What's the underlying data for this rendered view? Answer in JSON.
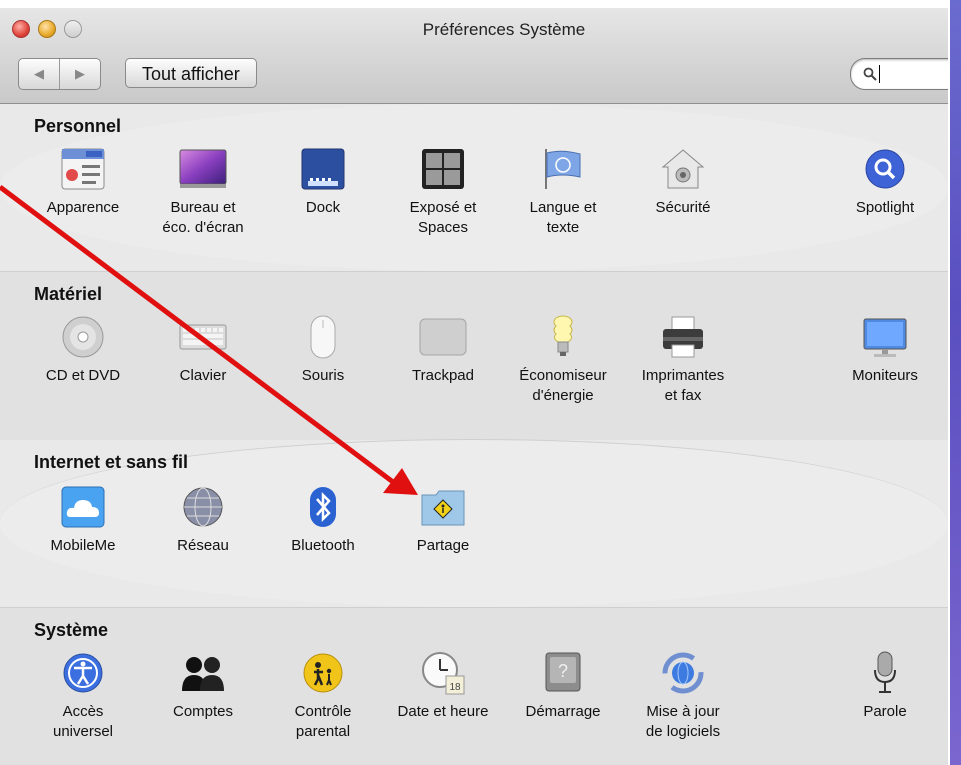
{
  "window": {
    "title": "Préférences Système"
  },
  "toolbar": {
    "back": "◀",
    "forward": "▶",
    "show_all": "Tout afficher"
  },
  "search": {
    "value": ""
  },
  "sections": [
    {
      "title": "Personnel",
      "items": [
        "Apparence",
        "Bureau et\néco. d'écran",
        "Dock",
        "Exposé et\nSpaces",
        "Langue et\ntexte",
        "Sécurité",
        "Spotlight"
      ]
    },
    {
      "title": "Matériel",
      "items": [
        "CD et DVD",
        "Clavier",
        "Souris",
        "Trackpad",
        "Économiseur\nd'énergie",
        "Imprimantes\net fax",
        "Moniteurs"
      ]
    },
    {
      "title": "Internet et sans fil",
      "items": [
        "MobileMe",
        "Réseau",
        "Bluetooth",
        "Partage"
      ]
    },
    {
      "title": "Système",
      "items": [
        "Accès\nuniversel",
        "Comptes",
        "Contrôle\nparental",
        "Date et heure",
        "Démarrage",
        "Mise à jour\nde logiciels",
        "Parole"
      ]
    }
  ],
  "icons": {
    "personnel": [
      "appearance-icon",
      "desktop-screensaver-icon",
      "dock-icon",
      "expose-spaces-icon",
      "language-text-icon",
      "security-icon",
      "spotlight-icon"
    ],
    "materiel": [
      "cd-dvd-icon",
      "keyboard-icon",
      "mouse-icon",
      "trackpad-icon",
      "energy-saver-icon",
      "printer-fax-icon",
      "monitor-icon"
    ],
    "internet": [
      "mobileme-icon",
      "network-icon",
      "bluetooth-icon",
      "sharing-icon"
    ],
    "systeme": [
      "universal-access-icon",
      "accounts-icon",
      "parental-controls-icon",
      "date-time-icon",
      "startup-disk-icon",
      "software-update-icon",
      "speech-icon"
    ]
  },
  "colors": {
    "arrow": "#e01010",
    "accent_purple": "#5a4fc0"
  }
}
